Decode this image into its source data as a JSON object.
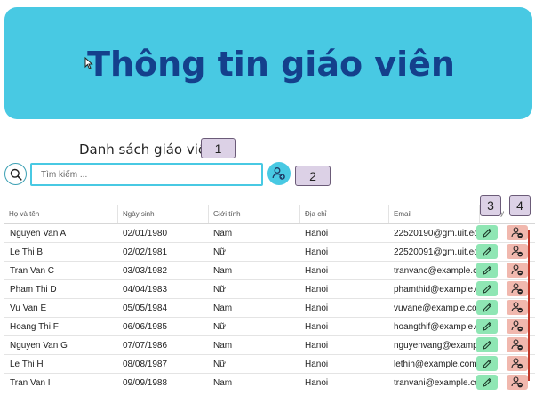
{
  "banner": {
    "title": "Thông tin giáo viên"
  },
  "list": {
    "title": "Danh sách giáo viên"
  },
  "search": {
    "placeholder": "Tìm kiếm ..."
  },
  "badges": [
    "1",
    "2",
    "3",
    "4"
  ],
  "table": {
    "columns": [
      "Họ và tên",
      "Ngày sinh",
      "Giới tính",
      "Địa chỉ",
      "Email"
    ],
    "action_header_fragment": "y",
    "rows": [
      {
        "name": "Nguyen Van A",
        "dob": "02/01/1980",
        "gender": "Nam",
        "address": "Hanoi",
        "email": "22520190@gm.uit.edu"
      },
      {
        "name": "Le Thi B",
        "dob": "02/02/1981",
        "gender": "Nữ",
        "address": "Hanoi",
        "email": "22520091@gm.uit.edu"
      },
      {
        "name": "Tran Van C",
        "dob": "03/03/1982",
        "gender": "Nam",
        "address": "Hanoi",
        "email": "tranvanc@example.co"
      },
      {
        "name": "Pham Thi D",
        "dob": "04/04/1983",
        "gender": "Nữ",
        "address": "Hanoi",
        "email": "phamthid@example.co"
      },
      {
        "name": "Vu Van E",
        "dob": "05/05/1984",
        "gender": "Nam",
        "address": "Hanoi",
        "email": "vuvane@example.com"
      },
      {
        "name": "Hoang Thi F",
        "dob": "06/06/1985",
        "gender": "Nữ",
        "address": "Hanoi",
        "email": "hoangthif@example.co"
      },
      {
        "name": "Nguyen Van G",
        "dob": "07/07/1986",
        "gender": "Nam",
        "address": "Hanoi",
        "email": "nguyenvang@example"
      },
      {
        "name": "Le Thi H",
        "dob": "08/08/1987",
        "gender": "Nữ",
        "address": "Hanoi",
        "email": "lethih@example.com"
      },
      {
        "name": "Tran Van I",
        "dob": "09/09/1988",
        "gender": "Nam",
        "address": "Hanoi",
        "email": "tranvani@example.com"
      }
    ]
  },
  "icons": {
    "search": "search-icon",
    "add_user": "add-user-icon",
    "edit": "pencil-icon",
    "delete": "remove-user-icon"
  },
  "colors": {
    "banner": "#48c9e3",
    "title": "#14408c",
    "edit_button": "#8fe6b4",
    "delete_button": "#f1b8ae",
    "badge": "#dcd1e6"
  }
}
